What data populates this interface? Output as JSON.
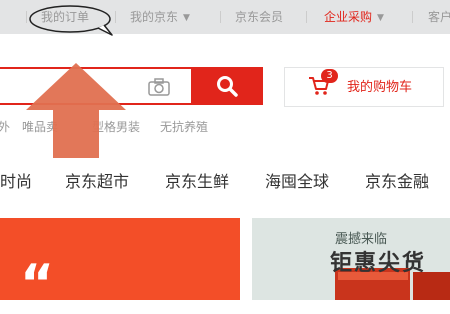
{
  "topbar": {
    "my_orders": "我的订单",
    "my_jd": "我的京东",
    "jd_member": "京东会员",
    "enterprise_purchase": "企业采购",
    "customer_service": "客户"
  },
  "search": {
    "placeholder": "",
    "hot_words": [
      "外",
      "唯品卖",
      "型格男装",
      "无抗养殖"
    ]
  },
  "cart": {
    "label": "我的购物车",
    "count": "3"
  },
  "nav": {
    "items": [
      "时尚",
      "京东超市",
      "京东生鲜",
      "海囤全球",
      "京东金融"
    ]
  },
  "banner": {
    "right_sub": "震撼来临",
    "right_title": "钜惠尖货",
    "left_big": "“"
  },
  "colors": {
    "brand_red": "#e1251b",
    "topbar_bg": "#e3e4e5",
    "annotation_arrow": "#e07050"
  }
}
